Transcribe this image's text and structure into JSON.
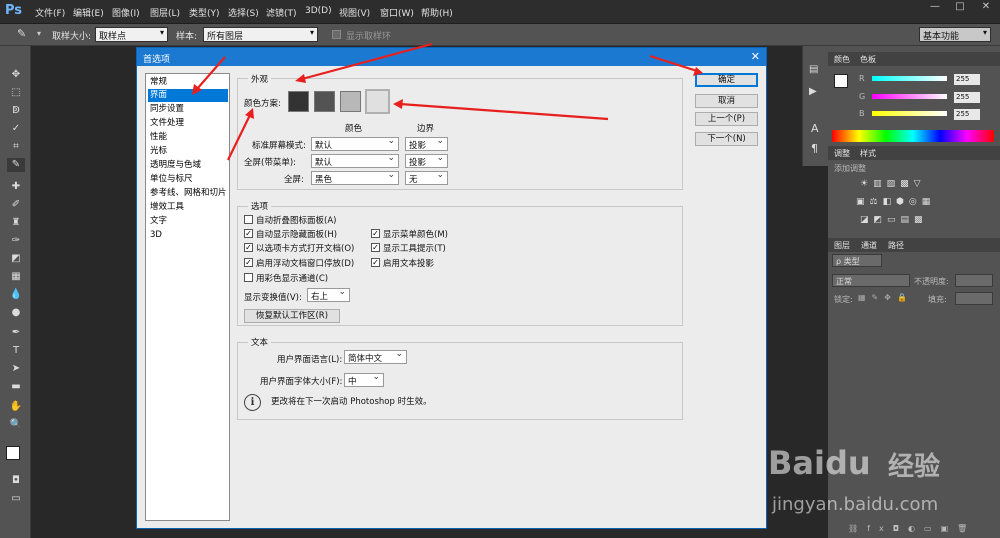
{
  "app": {
    "logo": "Ps"
  },
  "menu": [
    "文件(F)",
    "编辑(E)",
    "图像(I)",
    "图层(L)",
    "类型(Y)",
    "选择(S)",
    "滤镜(T)",
    "3D(D)",
    "视图(V)",
    "窗口(W)",
    "帮助(H)"
  ],
  "window_controls": [
    "—",
    "□",
    "✕"
  ],
  "options_bar": {
    "sample_size_label": "取样大小:",
    "sample_size_value": "取样点",
    "sample_label": "样本:",
    "sample_value": "所有图层",
    "show_ring_label": "显示取样环",
    "workspace_value": "基本功能"
  },
  "panels": {
    "color_tabs": [
      "颜色",
      "色板"
    ],
    "color_values": {
      "r_label": "R",
      "g_label": "G",
      "b_label": "B",
      "r": "255",
      "g": "255",
      "b": "255"
    },
    "adjust_tabs": [
      "调整",
      "样式"
    ],
    "add_adjustment": "添加调整",
    "layers_tabs": [
      "图层",
      "通道",
      "路径"
    ],
    "layers_kind": "ρ 类型",
    "blend_mode": "正常",
    "opacity_label": "不透明度:",
    "lock_label": "锁定:",
    "fill_label": "填充:"
  },
  "dialog": {
    "title": "首选项",
    "categories": [
      "常规",
      "界面",
      "同步设置",
      "文件处理",
      "性能",
      "光标",
      "透明度与色域",
      "单位与标尺",
      "参考线、网格和切片",
      "增效工具",
      "文字",
      "3D"
    ],
    "selected_category_index": 1,
    "appearance": {
      "title": "外观",
      "color_scheme_label": "颜色方案:",
      "swatch_colors": [
        "#333333",
        "#535353",
        "#b8b8b8",
        "#e0e0e0"
      ],
      "col_color": "颜色",
      "col_border": "边界",
      "rows": [
        {
          "label": "标准屏幕模式:",
          "color": "默认",
          "border": "投影"
        },
        {
          "label": "全屏(带菜单):",
          "color": "默认",
          "border": "投影"
        },
        {
          "label": "全屏:",
          "color": "黑色",
          "border": "无"
        }
      ]
    },
    "options": {
      "title": "选项",
      "checks_left": [
        {
          "label": "自动折叠图标面板(A)",
          "checked": false
        },
        {
          "label": "自动显示隐藏面板(H)",
          "checked": true
        },
        {
          "label": "以选项卡方式打开文档(O)",
          "checked": true
        },
        {
          "label": "启用浮动文档窗口停放(D)",
          "checked": true
        },
        {
          "label": "用彩色显示通道(C)",
          "checked": false
        }
      ],
      "checks_right": [
        {
          "label": "显示菜单颜色(M)",
          "checked": true
        },
        {
          "label": "显示工具提示(T)",
          "checked": true
        },
        {
          "label": "启用文本投影",
          "checked": true
        }
      ],
      "transform_label": "显示变换值(V):",
      "transform_value": "右上",
      "restore_button": "恢复默认工作区(R)"
    },
    "text": {
      "title": "文本",
      "ui_lang_label": "用户界面语言(L):",
      "ui_lang_value": "简体中文",
      "ui_font_label": "用户界面字体大小(F):",
      "ui_font_value": "中",
      "info": "更改将在下一次启动 Photoshop 时生效。"
    },
    "buttons": [
      "确定",
      "取消",
      "上一个(P)",
      "下一个(N)"
    ]
  },
  "watermark": {
    "brand": "Baidu",
    "brand2": "经验",
    "url": "jingyan.baidu.com"
  },
  "colors": {
    "accent": "#0078d7",
    "arrow": "#e8201d"
  }
}
